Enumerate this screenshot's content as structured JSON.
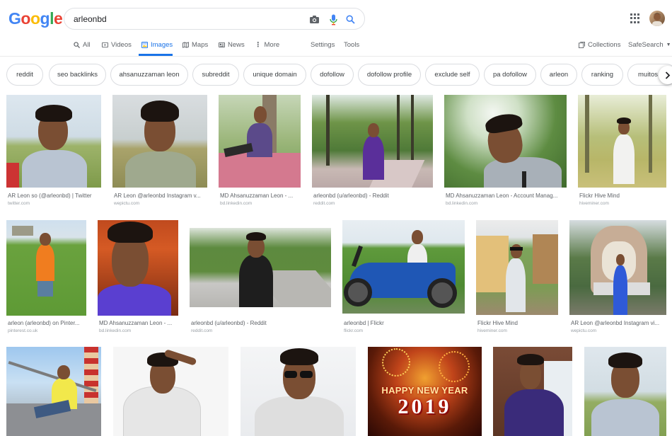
{
  "header": {
    "logo_letters": [
      "G",
      "o",
      "o",
      "g",
      "l",
      "e"
    ],
    "logo_colors": [
      "#4285f4",
      "#ea4335",
      "#fbbc05",
      "#4285f4",
      "#34a853",
      "#ea4335"
    ],
    "search_value": "arleonbd",
    "icons": {
      "camera": "camera-icon",
      "mic": "microphone-icon",
      "search": "search-icon",
      "apps": "apps-grid-icon"
    }
  },
  "tabs": {
    "all": "All",
    "videos": "Videos",
    "images": "Images",
    "maps": "Maps",
    "news": "News",
    "more": "More",
    "settings": "Settings",
    "tools": "Tools",
    "collections": "Collections",
    "safesearch": "SafeSearch"
  },
  "chips": [
    "reddit",
    "seo backlinks",
    "ahsanuzzaman leon",
    "subreddit",
    "unique domain",
    "dofollow",
    "dofollow profile",
    "exclude self",
    "pa dofollow",
    "arleon",
    "ranking",
    "muitos o"
  ],
  "results": [
    {
      "title": "AR Leon so (@arleonbd) | Twitter",
      "source": "twitter.com"
    },
    {
      "title": "AR Leon @arleonbd Instagram v...",
      "source": "wepictu.com"
    },
    {
      "title": "MD Ahsanuzzaman Leon - ...",
      "source": "bd.linkedin.com"
    },
    {
      "title": "arleonbd (u/arleonbd) - Reddit",
      "source": "reddit.com"
    },
    {
      "title": "MD Ahsanuzzaman Leon - Account Manag...",
      "source": "bd.linkedin.com"
    },
    {
      "title": "Flickr Hive Mind",
      "source": "hiveminer.com"
    },
    {
      "title": "arleon (arleonbd) on Pinter...",
      "source": "pinterest.co.uk"
    },
    {
      "title": "MD Ahsanuzzaman Leon - ...",
      "source": "bd.linkedin.com"
    },
    {
      "title": "arleonbd (u/arleonbd) - Reddit",
      "source": "reddit.com"
    },
    {
      "title": "arleonbd | Flickr",
      "source": "flickr.com"
    },
    {
      "title": "Flickr Hive Mind",
      "source": "hiveminer.com"
    },
    {
      "title": "AR Leon @arleonbd Instagram vi...",
      "source": "wepictu.com"
    }
  ],
  "new_year_image": {
    "line1": "HAPPY NEW YEAR",
    "line2": "2019"
  },
  "colors": {
    "accent": "#1a73e8",
    "text_secondary": "#5f6368"
  }
}
